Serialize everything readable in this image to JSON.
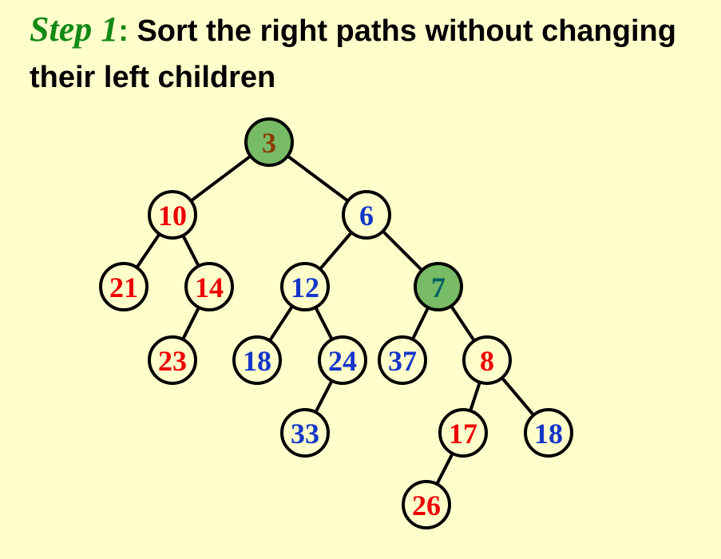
{
  "title": {
    "step_label": "Step 1",
    "colon": ":",
    "text": " Sort the right paths without changing their left children"
  },
  "tree": {
    "colors": {
      "red": "#ee0000",
      "blue": "#1536c8",
      "brown": "#8a3c00",
      "teal": "#006060",
      "node_fill": "#ffffcc",
      "highlight_fill": "#77bb66",
      "edge": "#000000"
    },
    "nodes": [
      {
        "id": "n3",
        "label": "3",
        "color": "brown",
        "highlight": true
      },
      {
        "id": "n10",
        "label": "10",
        "color": "red",
        "highlight": false
      },
      {
        "id": "n6",
        "label": "6",
        "color": "blue",
        "highlight": false
      },
      {
        "id": "n21",
        "label": "21",
        "color": "red",
        "highlight": false
      },
      {
        "id": "n14",
        "label": "14",
        "color": "red",
        "highlight": false
      },
      {
        "id": "n12",
        "label": "12",
        "color": "blue",
        "highlight": false
      },
      {
        "id": "n7",
        "label": "7",
        "color": "teal",
        "highlight": true
      },
      {
        "id": "n23",
        "label": "23",
        "color": "red",
        "highlight": false
      },
      {
        "id": "n18a",
        "label": "18",
        "color": "blue",
        "highlight": false
      },
      {
        "id": "n24",
        "label": "24",
        "color": "blue",
        "highlight": false
      },
      {
        "id": "n37",
        "label": "37",
        "color": "blue",
        "highlight": false
      },
      {
        "id": "n8",
        "label": "8",
        "color": "red",
        "highlight": false
      },
      {
        "id": "n33",
        "label": "33",
        "color": "blue",
        "highlight": false
      },
      {
        "id": "n17",
        "label": "17",
        "color": "red",
        "highlight": false
      },
      {
        "id": "n18b",
        "label": "18",
        "color": "blue",
        "highlight": false
      },
      {
        "id": "n26",
        "label": "26",
        "color": "red",
        "highlight": false
      }
    ],
    "edges": [
      {
        "from": "n3",
        "to": "n10"
      },
      {
        "from": "n3",
        "to": "n6"
      },
      {
        "from": "n10",
        "to": "n21"
      },
      {
        "from": "n10",
        "to": "n14"
      },
      {
        "from": "n14",
        "to": "n23"
      },
      {
        "from": "n6",
        "to": "n12"
      },
      {
        "from": "n6",
        "to": "n7"
      },
      {
        "from": "n12",
        "to": "n18a"
      },
      {
        "from": "n12",
        "to": "n24"
      },
      {
        "from": "n24",
        "to": "n33"
      },
      {
        "from": "n7",
        "to": "n37"
      },
      {
        "from": "n7",
        "to": "n8"
      },
      {
        "from": "n8",
        "to": "n17"
      },
      {
        "from": "n8",
        "to": "n18b"
      },
      {
        "from": "n17",
        "to": "n26"
      }
    ]
  }
}
